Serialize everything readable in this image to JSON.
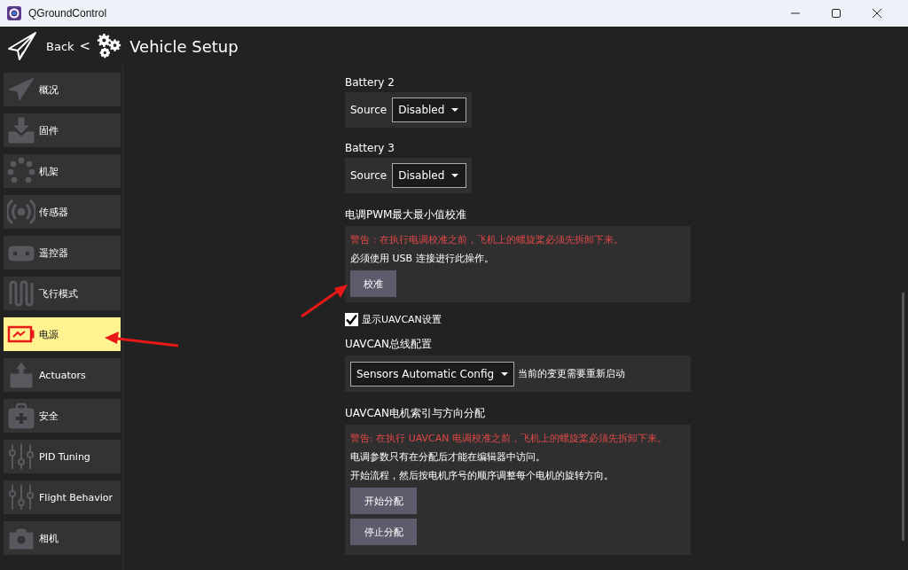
{
  "window": {
    "title": "QGroundControl"
  },
  "header": {
    "back": "Back",
    "separator": "<",
    "title": "Vehicle Setup"
  },
  "sidebar": {
    "items": [
      {
        "label": "概况",
        "selected": false
      },
      {
        "label": "固件",
        "selected": false
      },
      {
        "label": "机架",
        "selected": false
      },
      {
        "label": "传感器",
        "selected": false
      },
      {
        "label": "遥控器",
        "selected": false
      },
      {
        "label": "飞行模式",
        "selected": false
      },
      {
        "label": "电源",
        "selected": true
      },
      {
        "label": "Actuators",
        "selected": false
      },
      {
        "label": "安全",
        "selected": false
      },
      {
        "label": "PID Tuning",
        "selected": false
      },
      {
        "label": "Flight Behavior",
        "selected": false
      },
      {
        "label": "相机",
        "selected": false
      }
    ]
  },
  "batteries": [
    {
      "title": "Battery 2",
      "source_label": "Source",
      "source_value": "Disabled"
    },
    {
      "title": "Battery 3",
      "source_label": "Source",
      "source_value": "Disabled"
    }
  ],
  "esc_calibration": {
    "title": "电调PWM最大最小值校准",
    "warning": "警告：在执行电调校准之前，飞机上的螺旋桨必须先拆卸下来。",
    "note": "必须使用 USB 连接进行此操作。",
    "button": "校准"
  },
  "uavcan_toggle": {
    "label": "显示UAVCAN设置",
    "checked": true
  },
  "uavcan_bus": {
    "title": "UAVCAN总线配置",
    "value": "Sensors Automatic Config",
    "note": "当前的变更需要重新启动"
  },
  "uavcan_assignment": {
    "title": "UAVCAN电机索引与方向分配",
    "warning": "警告: 在执行 UAVCAN 电调校准之前，飞机上的螺旋桨必须先拆卸下来。",
    "lines": [
      "电调参数只有在分配后才能在编辑器中访问。",
      "开始流程，然后按电机序号的顺序调整每个电机的旋转方向。"
    ],
    "buttons": [
      "开始分配",
      "停止分配"
    ]
  }
}
